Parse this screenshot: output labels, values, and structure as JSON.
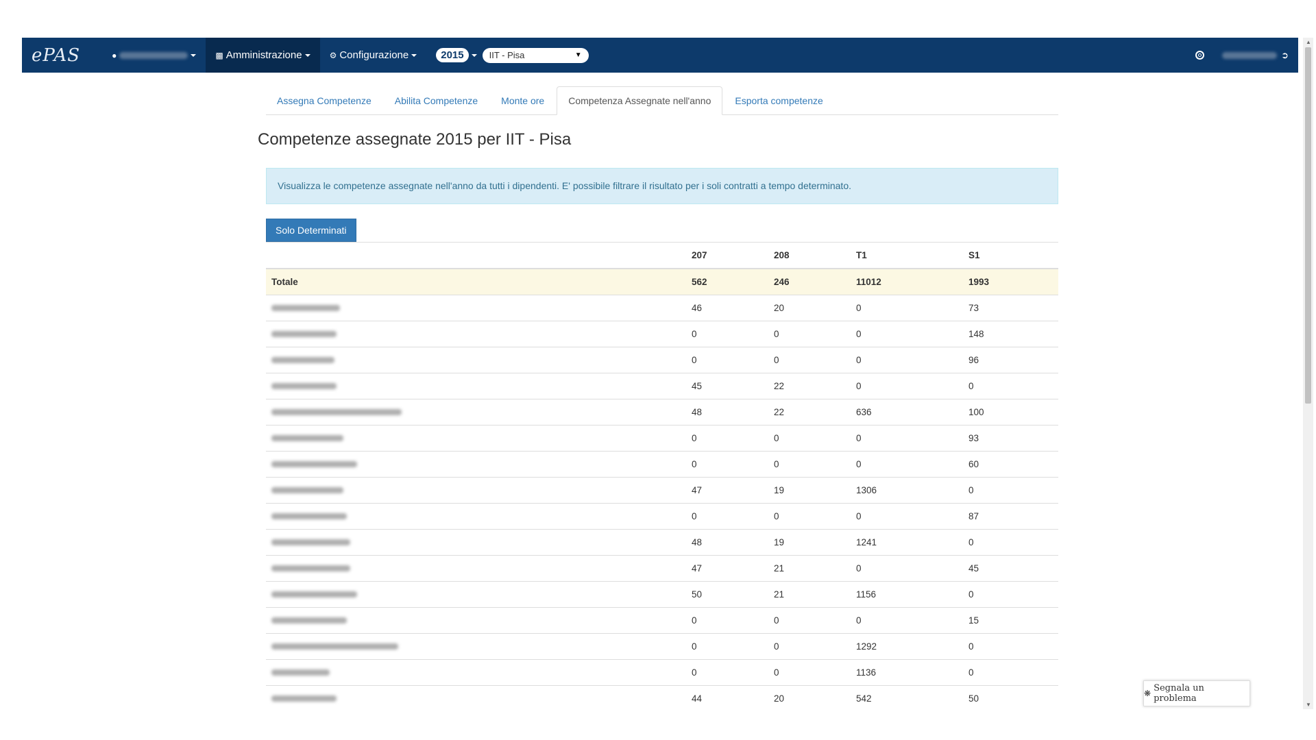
{
  "navbar": {
    "brand": "ePAS",
    "user_menu_icon": "user-icon",
    "admin_label": "Amministrazione",
    "admin_icon": "bar-chart-icon",
    "config_label": "Configurazione",
    "config_icon": "gear-icon",
    "year": "2015",
    "office": "IIT - Pisa",
    "help_icon": "lifebuoy-icon",
    "logout_icon": "logout-icon",
    "colors": {
      "bar": "#0d3a6b",
      "active": "#082a4f"
    }
  },
  "tabs": [
    {
      "label": "Assegna Competenze",
      "active": false
    },
    {
      "label": "Abilita Competenze",
      "active": false
    },
    {
      "label": "Monte ore",
      "active": false
    },
    {
      "label": "Competenza Assegnate nell'anno",
      "active": true
    },
    {
      "label": "Esporta competenze",
      "active": false
    }
  ],
  "title": "Competenze assegnate 2015 per IIT - Pisa",
  "alert": "Visualizza le competenze assegnate nell'anno da tutti i dipendenti. E' possibile filtrare il risultato per i soli contratti a tempo determinato.",
  "filter_button": "Solo Determinati",
  "table": {
    "columns": [
      "",
      "207",
      "208",
      "T1",
      "S1"
    ],
    "total": {
      "label": "Totale",
      "values": [
        "562",
        "246",
        "11012",
        "1993"
      ]
    },
    "rows": [
      [
        "46",
        "20",
        "0",
        "73"
      ],
      [
        "0",
        "0",
        "0",
        "148"
      ],
      [
        "0",
        "0",
        "0",
        "96"
      ],
      [
        "45",
        "22",
        "0",
        "0"
      ],
      [
        "48",
        "22",
        "636",
        "100"
      ],
      [
        "0",
        "0",
        "0",
        "93"
      ],
      [
        "0",
        "0",
        "0",
        "60"
      ],
      [
        "47",
        "19",
        "1306",
        "0"
      ],
      [
        "0",
        "0",
        "0",
        "87"
      ],
      [
        "48",
        "19",
        "1241",
        "0"
      ],
      [
        "47",
        "21",
        "0",
        "45"
      ],
      [
        "50",
        "21",
        "1156",
        "0"
      ],
      [
        "0",
        "0",
        "0",
        "15"
      ],
      [
        "0",
        "0",
        "1292",
        "0"
      ],
      [
        "0",
        "0",
        "1136",
        "0"
      ],
      [
        "44",
        "20",
        "542",
        "50"
      ]
    ]
  },
  "report_button": {
    "label": "Segnala un problema",
    "icon": "bug-icon"
  }
}
